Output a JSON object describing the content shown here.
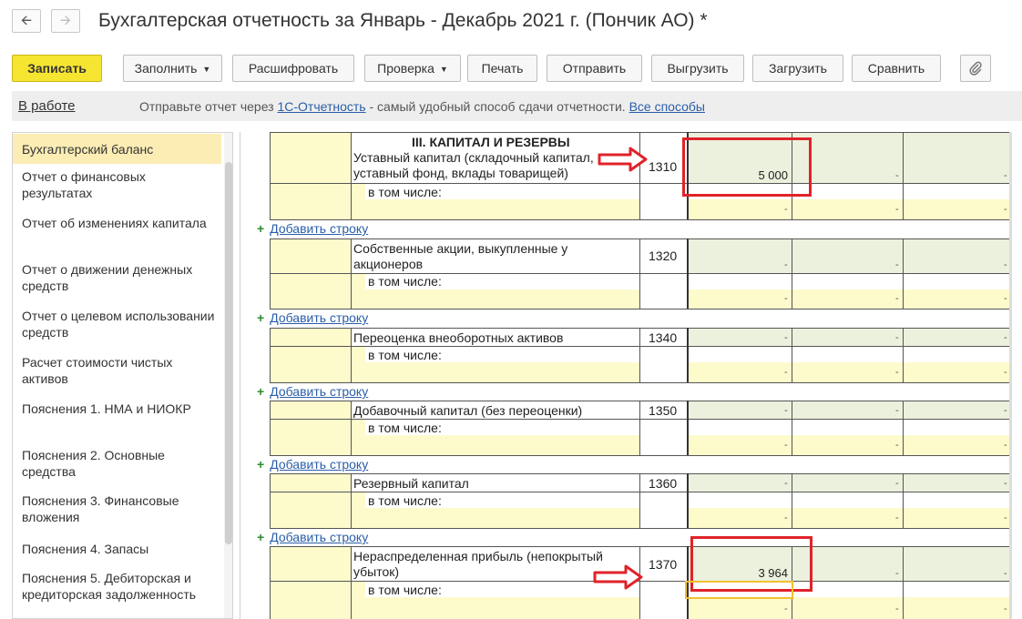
{
  "window": {
    "title": "Бухгалтерская отчетность за Январь - Декабрь 2021 г. (Пончик АО) *",
    "back_icon": "arrow-left-icon",
    "forward_icon": "arrow-right-icon"
  },
  "toolbar": {
    "save": "Записать",
    "fill": "Заполнить",
    "decode": "Расшифровать",
    "check": "Проверка",
    "print": "Печать",
    "send": "Отправить",
    "export": "Выгрузить",
    "import": "Загрузить",
    "compare": "Сравнить",
    "attach_icon": "paperclip-icon"
  },
  "infobar": {
    "status": "В работе",
    "text_before": "Отправьте отчет через ",
    "link1": "1С-Отчетность",
    "text_middle": " - самый удобный способ сдачи отчетности. ",
    "link2": "Все способы"
  },
  "sidebar": {
    "items": [
      {
        "label": "Бухгалтерский баланс",
        "active": true
      },
      {
        "label": "Отчет о финансовых результатах"
      },
      {
        "label": "Отчет об изменениях капитала"
      },
      {
        "label": "Отчет о движении денежных средств"
      },
      {
        "label": "Отчет о целевом использовании средств"
      },
      {
        "label": "Расчет стоимости чистых активов"
      },
      {
        "label": "Пояснения 1. НМА и НИОКР"
      },
      {
        "label": "Пояснения 2. Основные средства"
      },
      {
        "label": "Пояснения 3. Финансовые вложения"
      },
      {
        "label": "Пояснения 4. Запасы"
      },
      {
        "label": "Пояснения 5. Дебиторская и кредиторская задолженность"
      }
    ]
  },
  "report": {
    "section_title": "III. КАПИТАЛ И РЕЗЕРВЫ",
    "sub_label": "в том числе:",
    "add_row": "Добавить строку",
    "dash": "-",
    "rows": [
      {
        "label": "Уставный капитал (складочный капитал, уставный фонд, вклады товарищей)",
        "code": "1310",
        "value": "5 000"
      },
      {
        "label": "Собственные акции, выкупленные у акционеров",
        "code": "1320",
        "value": ""
      },
      {
        "label": "Переоценка внеоборотных активов",
        "code": "1340",
        "value": ""
      },
      {
        "label": "Добавочный капитал (без переоценки)",
        "code": "1350",
        "value": ""
      },
      {
        "label": "Резервный капитал",
        "code": "1360",
        "value": ""
      },
      {
        "label": "Нераспределенная прибыль (непокрытый убыток)",
        "code": "1370",
        "value": "3 964"
      }
    ]
  },
  "colors": {
    "primary_button": "#f5e531",
    "highlight_red": "#e0232a",
    "highlight_orange": "#f2c12e",
    "cell_yellow": "#fdfbcc",
    "cell_green": "#ebf1dd",
    "link": "#2a5ea8"
  }
}
